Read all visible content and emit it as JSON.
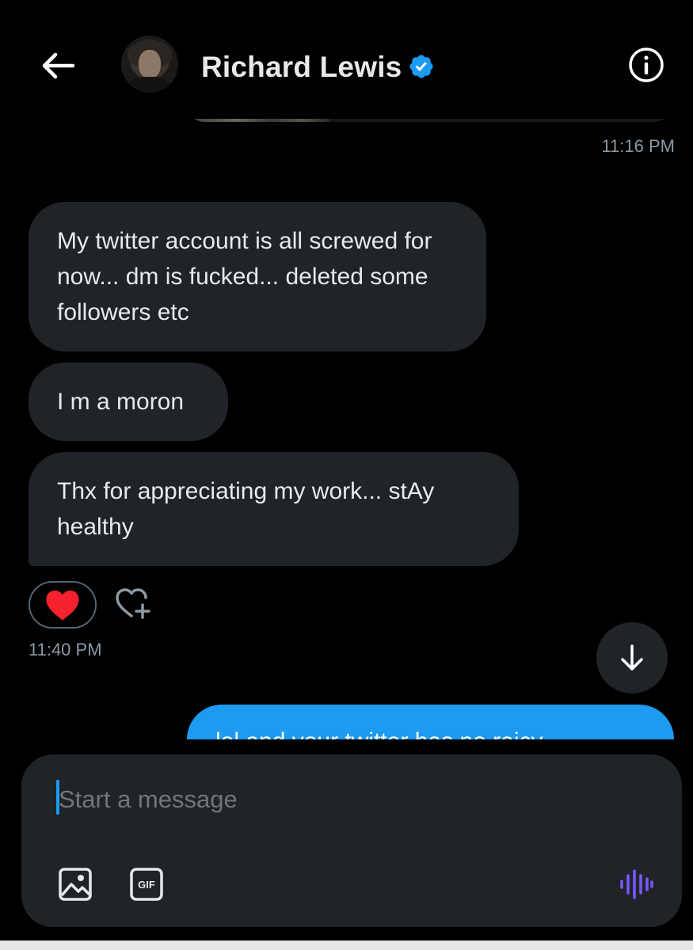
{
  "header": {
    "contact_name": "Richard Lewis",
    "verified": true,
    "icons": {
      "back": "arrow-left-icon",
      "verified": "verified-badge-icon",
      "info": "info-icon"
    }
  },
  "conversation": {
    "top_timestamp": "11:16 PM",
    "incoming_messages": [
      {
        "text": "My twitter account is all screwed for now... dm is fucked... deleted some followers etc"
      },
      {
        "text": "I m a moron"
      },
      {
        "text": "Thx for appreciating my work... stAy healthy"
      }
    ],
    "reaction": {
      "emoji": "heart",
      "count_visible": false
    },
    "bottom_timestamp": "11:40 PM",
    "outgoing_partial_text": "lol and your twitter has no raicy"
  },
  "composer": {
    "placeholder": "Start a message",
    "value": "",
    "icons": {
      "image": "image-icon",
      "gif": "gif-icon",
      "voice": "voice-message-icon"
    }
  },
  "colors": {
    "background": "#000000",
    "incoming_bubble": "#202327",
    "outgoing_bubble": "#1d9bf0",
    "verified_badge": "#1d9bf0",
    "voice_icon": "#7856ff",
    "heart": "#f4212e",
    "secondary_text": "#8b98a5"
  }
}
